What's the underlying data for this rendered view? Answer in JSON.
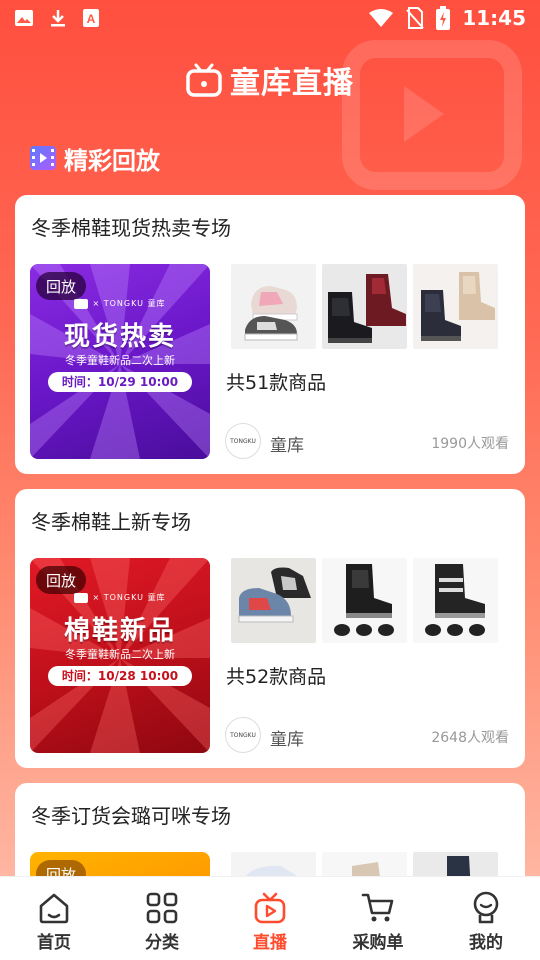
{
  "status_bar": {
    "time": "11:45"
  },
  "header": {
    "title": "童库直播"
  },
  "section": {
    "title": "精彩回放"
  },
  "cards": [
    {
      "title": "冬季棉鞋现货热卖专场",
      "badge": "回放",
      "poster_brand": "× TONGKU 童库",
      "poster_headline": "现货热卖",
      "poster_sub": "冬季童鞋新品二次上新",
      "poster_time": "时间：10/29 10:00",
      "poster_color": "#7b21d6",
      "poster_color2": "#4a0d9b",
      "time_color": "#6a1bc2",
      "product_count": "共51款商品",
      "seller_name": "童库",
      "seller_logo": "TONGKU",
      "views": "1990人观看"
    },
    {
      "title": "冬季棉鞋上新专场",
      "badge": "回放",
      "poster_brand": "× TONGKU 童库",
      "poster_headline": "棉鞋新品",
      "poster_sub": "冬季童鞋新品二次上新",
      "poster_time": "时间：10/28 10:00",
      "poster_color": "#d7121f",
      "poster_color2": "#8e0710",
      "time_color": "#c4101c",
      "product_count": "共52款商品",
      "seller_name": "童库",
      "seller_logo": "TONGKU",
      "views": "2648人观看"
    },
    {
      "title": "冬季订货会璐可咪专场",
      "badge": "回放",
      "poster_color": "#ffb000",
      "poster_color2": "#ff9800"
    }
  ],
  "nav": {
    "items": [
      {
        "label": "首页",
        "icon": "home-icon"
      },
      {
        "label": "分类",
        "icon": "category-icon"
      },
      {
        "label": "直播",
        "icon": "live-icon"
      },
      {
        "label": "采购单",
        "icon": "cart-icon"
      },
      {
        "label": "我的",
        "icon": "profile-icon"
      }
    ],
    "active": "直播",
    "active_color": "#ff4c2e"
  }
}
